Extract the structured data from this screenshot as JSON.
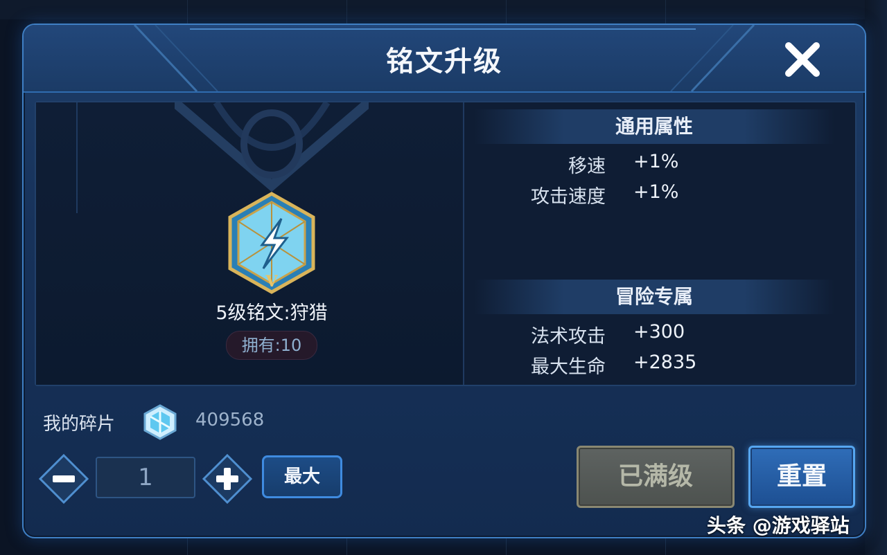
{
  "dialog": {
    "title": "铭文升级",
    "close_icon": "close-icon"
  },
  "rune": {
    "icon": "lightning-rune-icon",
    "level_mark": "V",
    "name": "5级铭文:狩猎",
    "owned": "拥有:10"
  },
  "general": {
    "heading": "通用属性",
    "stats": [
      {
        "label": "移速",
        "value": "+1%"
      },
      {
        "label": "攻击速度",
        "value": "+1%"
      }
    ]
  },
  "adventure": {
    "heading": "冒险专属",
    "stats": [
      {
        "label": "法术攻击",
        "value": "+300"
      },
      {
        "label": "最大生命",
        "value": "+2835"
      }
    ]
  },
  "shards": {
    "label": "我的碎片",
    "icon": "crystal-shard-icon",
    "value": "409568"
  },
  "controls": {
    "minus_icon": "minus-icon",
    "quantity": "1",
    "plus_icon": "plus-icon",
    "max_label": "最大",
    "maxed_label": "已满级",
    "reset_label": "重置"
  },
  "watermark": "头条 @游戏驿站",
  "colors": {
    "dialog_border": "#3f7fc4",
    "panel_bg": "#0f1d34",
    "accent_blue": "#3f8be0",
    "disabled_button": "#5e6361"
  }
}
